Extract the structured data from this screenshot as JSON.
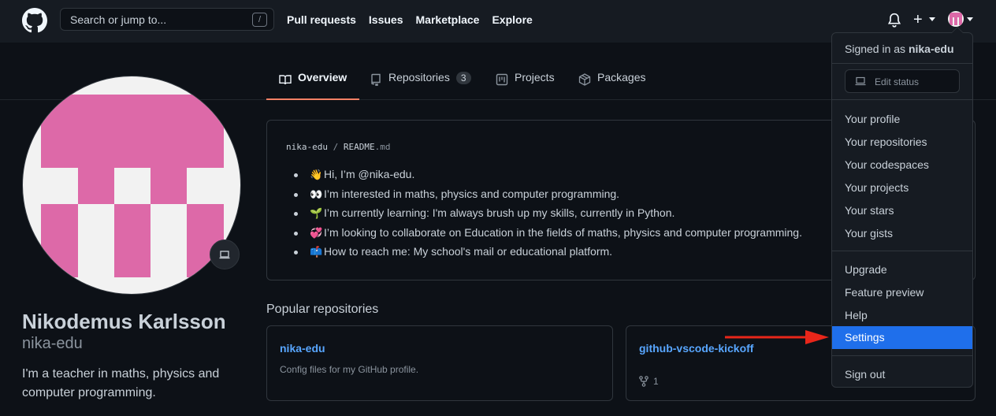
{
  "header": {
    "search_placeholder": "Search or jump to...",
    "search_shortcut": "/",
    "nav": [
      "Pull requests",
      "Issues",
      "Marketplace",
      "Explore"
    ],
    "plus_label": "+"
  },
  "tabs": [
    {
      "label": "Overview",
      "icon": "book-icon",
      "active": true
    },
    {
      "label": "Repositories",
      "icon": "repo-icon",
      "count": "3"
    },
    {
      "label": "Projects",
      "icon": "project-icon"
    },
    {
      "label": "Packages",
      "icon": "package-icon"
    }
  ],
  "profile": {
    "name": "Nikodemus Karlsson",
    "username": "nika-edu",
    "bio": "I'm a teacher in maths, physics and computer programming."
  },
  "readme": {
    "owner": "nika-edu",
    "separator": "/",
    "file": "README",
    "ext": ".md",
    "items": [
      {
        "emoji": "👋",
        "text": "Hi, I’m @nika-edu."
      },
      {
        "emoji": "👀",
        "text": "I’m interested in maths, physics and computer programming."
      },
      {
        "emoji": "🌱",
        "text": "I’m currently learning: I'm always brush up my skills, currently in Python."
      },
      {
        "emoji": "💞️",
        "text": "I’m looking to collaborate on Education in the fields of maths, physics and computer programming."
      },
      {
        "emoji": "📫",
        "text": "How to reach me: My school's mail or educational platform."
      }
    ]
  },
  "popular": {
    "title": "Popular repositories",
    "repos": [
      {
        "name": "nika-edu",
        "desc": "Config files for my GitHub profile."
      },
      {
        "name": "github-vscode-kickoff",
        "forks": "1"
      }
    ]
  },
  "dropdown": {
    "signed_prefix": "Signed in as",
    "signed_user": "nika-edu",
    "edit_status": "Edit status",
    "items": [
      "Your profile",
      "Your repositories",
      "Your codespaces",
      "Your projects",
      "Your stars",
      "Your gists"
    ],
    "items2": [
      "Upgrade",
      "Feature preview",
      "Help",
      "Settings"
    ],
    "sign_out": "Sign out",
    "highlighted": "Settings"
  },
  "colors": {
    "bg": "#0d1117",
    "header_bg": "#161b22",
    "accent_tab": "#f78166",
    "link": "#58a6ff",
    "highlight": "#1f6feb",
    "avatar_pink": "#dd69a8",
    "arrow_red": "#e8261a"
  }
}
